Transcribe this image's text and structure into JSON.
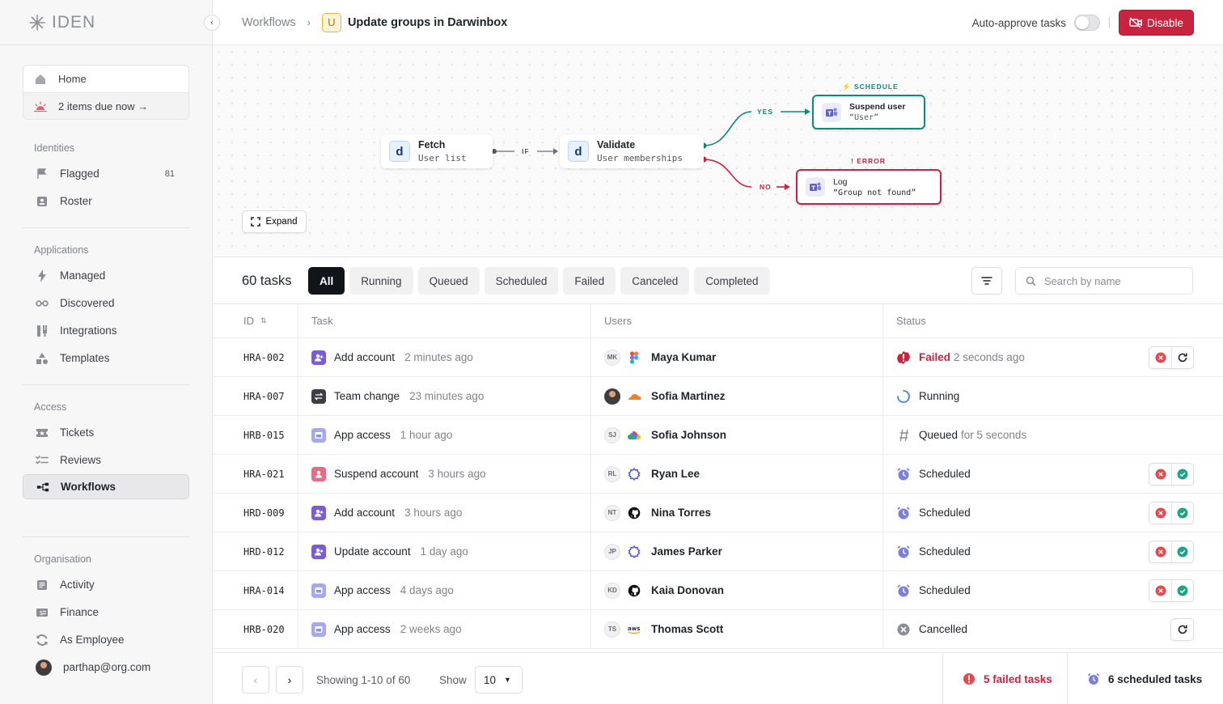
{
  "app": {
    "name": "IDEN"
  },
  "sidebar": {
    "home_label": "Home",
    "due_label": "2 items due now →",
    "sections": {
      "identities": "Identities",
      "applications": "Applications",
      "access": "Access",
      "organisation": "Organisation"
    },
    "identities": [
      {
        "label": "Flagged",
        "count": "81",
        "icon": "flag-icon"
      },
      {
        "label": "Roster",
        "icon": "id-card-icon"
      }
    ],
    "applications": [
      {
        "label": "Managed",
        "icon": "bolt-icon"
      },
      {
        "label": "Discovered",
        "icon": "glasses-icon"
      },
      {
        "label": "Integrations",
        "icon": "plug-icon"
      },
      {
        "label": "Templates",
        "icon": "shapes-icon"
      }
    ],
    "access": [
      {
        "label": "Tickets",
        "icon": "ticket-icon"
      },
      {
        "label": "Reviews",
        "icon": "checklist-icon"
      },
      {
        "label": "Workflows",
        "icon": "workflow-icon",
        "active": true
      }
    ],
    "organisation": [
      {
        "label": "Activity",
        "icon": "activity-icon"
      },
      {
        "label": "Finance",
        "icon": "finance-icon"
      },
      {
        "label": "As Employee",
        "icon": "switch-icon"
      }
    ],
    "user_email": "parthap@org.com"
  },
  "header": {
    "breadcrumb_root": "Workflows",
    "workflow_badge": "U",
    "workflow_title": "Update groups in Darwinbox",
    "auto_approve_label": "Auto-approve tasks",
    "auto_approve_on": false,
    "disable_label": "Disable"
  },
  "workflow": {
    "nodes": {
      "fetch": {
        "title": "Fetch",
        "subtitle": "User list",
        "logo": "d"
      },
      "validate": {
        "title": "Validate",
        "subtitle": "User memberships",
        "logo": "d"
      },
      "suspend": {
        "title": "Suspend user",
        "subtitle": "“User”",
        "tag": "SCHEDULE"
      },
      "log": {
        "title": "Log",
        "subtitle": "“Group not found”",
        "tag": "ERROR"
      }
    },
    "edge_labels": {
      "if": "IF",
      "yes": "YES",
      "no": "NO"
    },
    "expand_label": "Expand"
  },
  "tasks": {
    "count_label": "60 tasks",
    "tabs": [
      "All",
      "Running",
      "Queued",
      "Scheduled",
      "Failed",
      "Canceled",
      "Completed"
    ],
    "active_tab": "All",
    "search_placeholder": "Search by name",
    "columns": {
      "id": "ID",
      "task": "Task",
      "users": "Users",
      "status": "Status"
    },
    "rows": [
      {
        "id": "HRA-002",
        "task": "Add account",
        "time": "2 minutes ago",
        "task_icon": "add-user",
        "initials": "MK",
        "app": "figma",
        "user": "Maya Kumar",
        "status": "Failed",
        "status_detail": "2 seconds ago",
        "actions": [
          "cancel",
          "retry"
        ]
      },
      {
        "id": "HRA-007",
        "task": "Team change",
        "time": "23 minutes ago",
        "task_icon": "swap",
        "initials": "",
        "app": "cloudflare",
        "user": "Sofia Martinez",
        "status": "Running",
        "status_detail": "",
        "actions": []
      },
      {
        "id": "HRB-015",
        "task": "App access",
        "time": "1 hour ago",
        "task_icon": "app",
        "initials": "SJ",
        "app": "gcp",
        "user": "Sofia Johnson",
        "status": "Queued",
        "status_detail": "for 5 seconds",
        "actions": []
      },
      {
        "id": "HRA-021",
        "task": "Suspend account",
        "time": "3 hours ago",
        "task_icon": "suspend",
        "initials": "RL",
        "app": "gear",
        "user": "Ryan Lee",
        "status": "Scheduled",
        "status_detail": "",
        "actions": [
          "cancel",
          "approve"
        ]
      },
      {
        "id": "HRD-009",
        "task": "Add account",
        "time": "3 hours ago",
        "task_icon": "add-user",
        "initials": "NT",
        "app": "github",
        "user": "Nina Torres",
        "status": "Scheduled",
        "status_detail": "",
        "actions": [
          "cancel",
          "approve"
        ]
      },
      {
        "id": "HRD-012",
        "task": "Update account",
        "time": "1 day ago",
        "task_icon": "add-user",
        "initials": "JP",
        "app": "gear",
        "user": "James Parker",
        "status": "Scheduled",
        "status_detail": "",
        "actions": [
          "cancel",
          "approve"
        ]
      },
      {
        "id": "HRA-014",
        "task": "App access",
        "time": "4 days ago",
        "task_icon": "app",
        "initials": "KD",
        "app": "github",
        "user": "Kaia Donovan",
        "status": "Scheduled",
        "status_detail": "",
        "actions": [
          "cancel",
          "approve"
        ]
      },
      {
        "id": "HRB-020",
        "task": "App access",
        "time": "2 weeks ago",
        "task_icon": "app",
        "initials": "TS",
        "app": "aws",
        "user": "Thomas Scott",
        "status": "Cancelled",
        "status_detail": "",
        "actions": [
          "retry"
        ]
      }
    ]
  },
  "footer": {
    "showing": "Showing 1-10 of 60",
    "show_label": "Show",
    "page_size": "10",
    "failed_tasks": "5 failed tasks",
    "scheduled_tasks": "6 scheduled tasks"
  },
  "colors": {
    "danger": "#c8233f",
    "success": "#0f8a7a",
    "scheduled": "#6c6fd8",
    "ink": "#111418"
  }
}
